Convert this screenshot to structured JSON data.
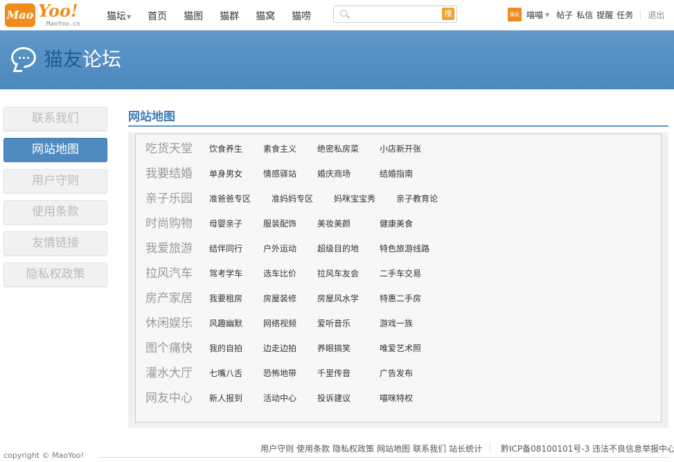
{
  "header": {
    "logo": {
      "badge": "Mao",
      "word": "Yoo!",
      "sub": "MaoYoo.cn"
    },
    "nav": [
      {
        "label": "猫坛",
        "dropdown": true
      },
      {
        "label": "首页"
      },
      {
        "label": "猫图"
      },
      {
        "label": "猫群"
      },
      {
        "label": "猫窝"
      },
      {
        "label": "猫唠"
      }
    ],
    "search": {
      "placeholder": "",
      "button": "搜"
    },
    "user": {
      "avatar_text": "猫友论坛",
      "name": "喵喵",
      "links": [
        "帖子",
        "私信",
        "提醒",
        "任务"
      ],
      "logout": "退出"
    }
  },
  "banner": {
    "title_part1": "猫友",
    "title_part2": "论坛"
  },
  "sidebar": {
    "items": [
      {
        "label": "联系我们",
        "active": false
      },
      {
        "label": "网站地图",
        "active": true
      },
      {
        "label": "用户守则",
        "active": false
      },
      {
        "label": "使用条款",
        "active": false
      },
      {
        "label": "友情链接",
        "active": false
      },
      {
        "label": "隐私权政策",
        "active": false
      }
    ]
  },
  "main": {
    "title": "网站地图",
    "sections": [
      {
        "name": "吃货天堂",
        "links": [
          "饮食养生",
          "素食主义",
          "绝密私房菜",
          "小店新开张"
        ]
      },
      {
        "name": "我要结婚",
        "links": [
          "单身男女",
          "情感驿站",
          "婚庆商场",
          "结婚指南"
        ]
      },
      {
        "name": "亲子乐园",
        "links": [
          "准爸爸专区",
          "准妈妈专区",
          "妈咪宝宝秀",
          "亲子教育论"
        ]
      },
      {
        "name": "时尚购物",
        "links": [
          "母婴亲子",
          "服装配饰",
          "美妆美颜",
          "健康美食"
        ]
      },
      {
        "name": "我爱旅游",
        "links": [
          "结伴同行",
          "户外运动",
          "超级目的地",
          "特色旅游线路"
        ]
      },
      {
        "name": "拉风汽车",
        "links": [
          "驾考学车",
          "选车比价",
          "拉风车友会",
          "二手车交易"
        ]
      },
      {
        "name": "房产家居",
        "links": [
          "我要租房",
          "房屋装修",
          "房屋风水学",
          "特惠二手房"
        ]
      },
      {
        "name": "休闲娱乐",
        "links": [
          "风趣幽默",
          "网络视频",
          "爱听音乐",
          "游戏一族"
        ]
      },
      {
        "name": "图个痛快",
        "links": [
          "我的自拍",
          "边走边拍",
          "养眼搞笑",
          "唯爱艺术照"
        ]
      },
      {
        "name": "灌水大厅",
        "links": [
          "七嘴八舌",
          "恐怖地带",
          "千里传音",
          "广告发布"
        ]
      },
      {
        "name": "网友中心",
        "links": [
          "新人报到",
          "活动中心",
          "投诉建议",
          "喵咪特权"
        ]
      }
    ]
  },
  "footer": {
    "links": [
      "用户守则",
      "使用条款",
      "隐私权政策",
      "网站地图",
      "联系我们",
      "站长统计"
    ],
    "icp": "黔ICP备08100101号-3 违法不良信息举报中心",
    "copyright": "copyright © MaoYoo!"
  }
}
